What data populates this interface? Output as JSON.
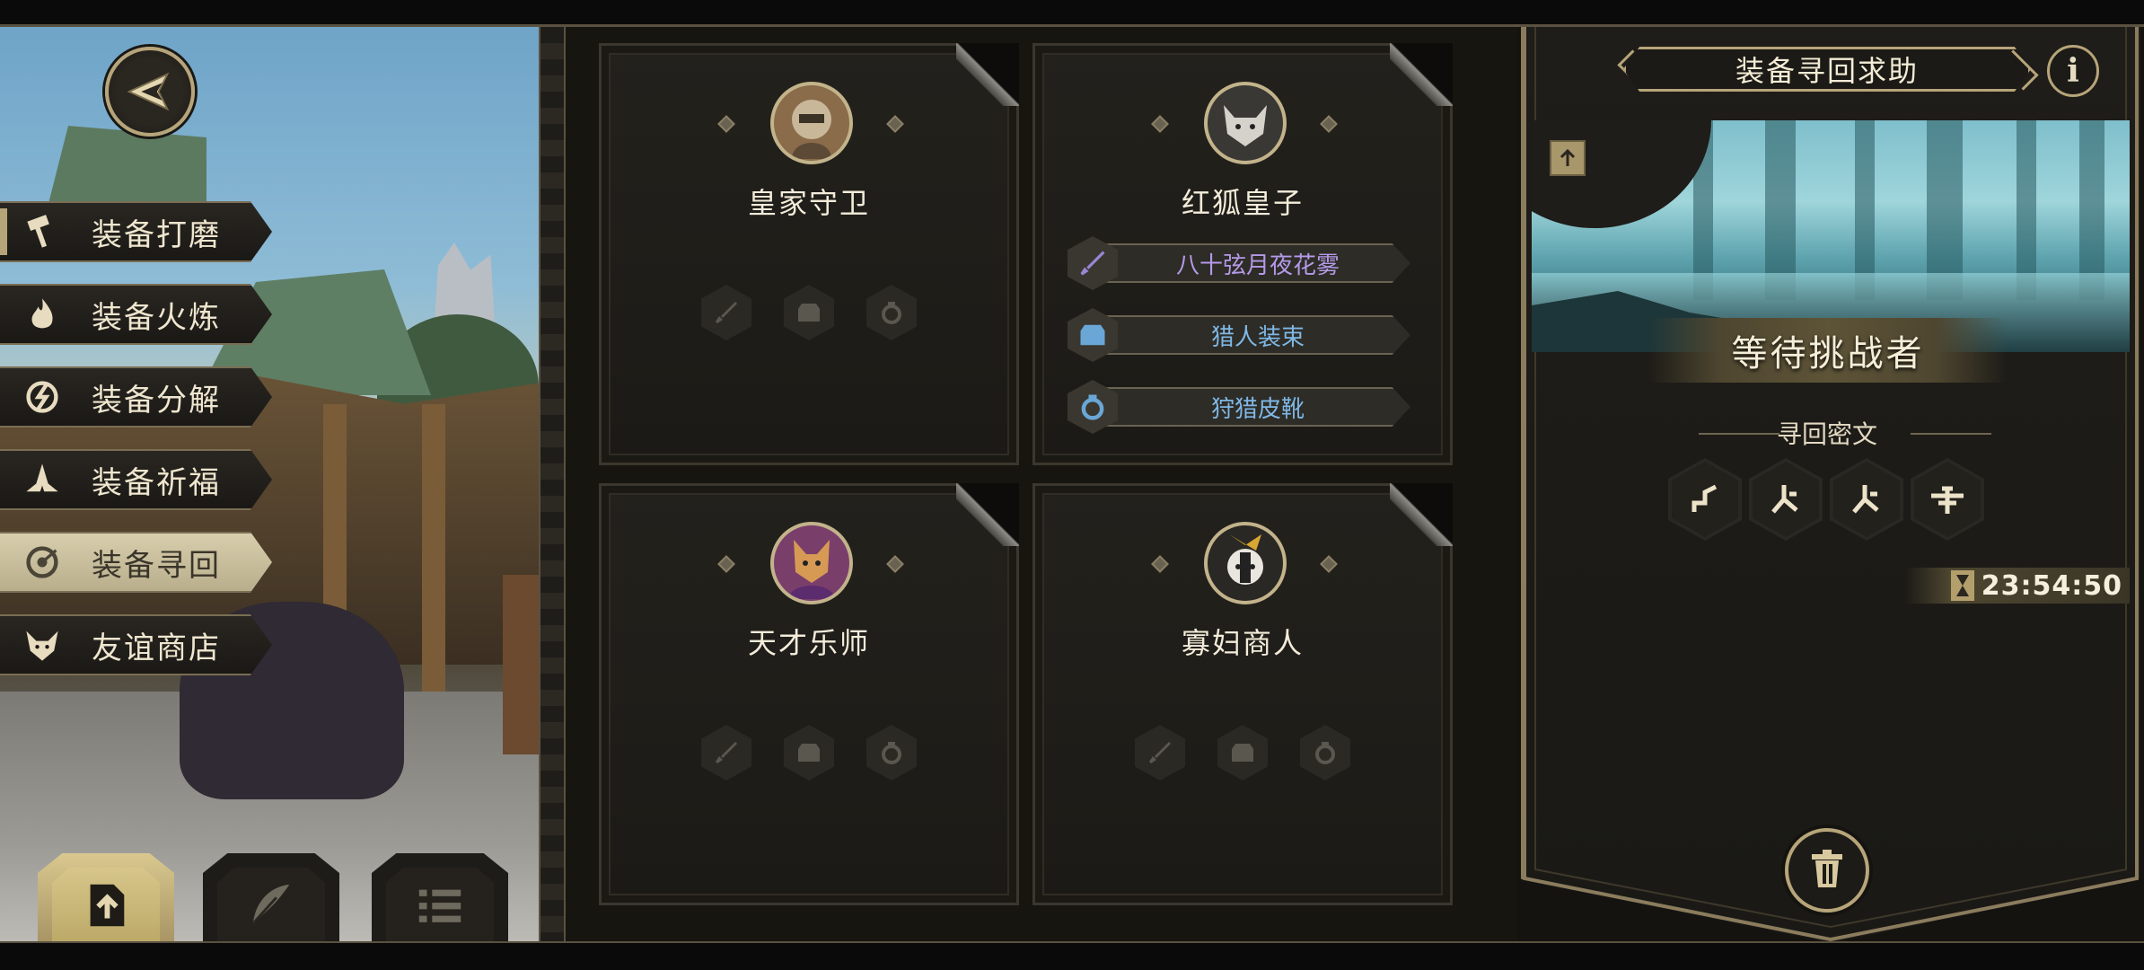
{
  "side_menu": {
    "items": [
      {
        "label": "装备打磨",
        "icon": "hammer-icon",
        "active": false
      },
      {
        "label": "装备火炼",
        "icon": "flame-icon",
        "active": false
      },
      {
        "label": "装备分解",
        "icon": "shatter-icon",
        "active": false
      },
      {
        "label": "装备祈福",
        "icon": "pray-hands-icon",
        "active": false
      },
      {
        "label": "装备寻回",
        "icon": "target-icon",
        "active": true
      },
      {
        "label": "友谊商店",
        "icon": "fox-icon",
        "active": false
      }
    ]
  },
  "bottom_buttons": [
    {
      "icon": "upload-icon",
      "active": true
    },
    {
      "icon": "feather-icon",
      "active": false
    },
    {
      "icon": "list-icon",
      "active": false
    }
  ],
  "cards": [
    {
      "name": "皇家守卫",
      "portrait": "guard-portrait",
      "equipment": []
    },
    {
      "name": "红狐皇子",
      "portrait": "wolf-portrait",
      "equipment": [
        {
          "name": "八十弦月夜花雾",
          "icon": "sword-icon",
          "color": "#b49ae8"
        },
        {
          "name": "猎人装束",
          "icon": "armor-icon",
          "color": "#7fb8e6"
        },
        {
          "name": "狩猎皮靴",
          "icon": "ring-icon",
          "color": "#7fb8e6"
        }
      ]
    },
    {
      "name": "天才乐师",
      "portrait": "dog-portrait",
      "equipment": []
    },
    {
      "name": "寡妇商人",
      "portrait": "badger-portrait",
      "equipment": []
    }
  ],
  "right_panel": {
    "title": "装备寻回求助",
    "info_label": "i",
    "status": "等待挑战者",
    "cipher_label": "寻回密文",
    "ciphers": [
      "rune-1-icon",
      "rune-2-icon",
      "rune-2-icon",
      "rune-3-icon"
    ],
    "timer": "23:54:50"
  },
  "colors": {
    "gold": "#b7a57a",
    "purple_item": "#b49ae8",
    "blue_item": "#7fb8e6"
  }
}
